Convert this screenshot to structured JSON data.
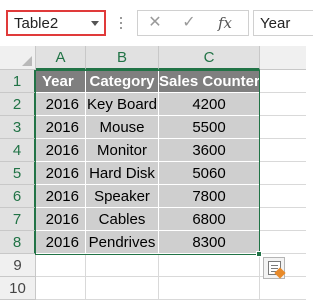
{
  "formula_bar": {
    "name_box": "Table2",
    "cancel_icon": "✕",
    "enter_icon": "✓",
    "fx_label": "fx",
    "content": "Year"
  },
  "columns": [
    "A",
    "B",
    "C"
  ],
  "rows": [
    "1",
    "2",
    "3",
    "4",
    "5",
    "6",
    "7",
    "8",
    "9",
    "10"
  ],
  "table": {
    "headers": [
      "Year",
      "Category",
      "Sales Counter"
    ],
    "data": [
      [
        "2016",
        "Key Board",
        "4200"
      ],
      [
        "2016",
        "Mouse",
        "5500"
      ],
      [
        "2016",
        "Monitor",
        "3600"
      ],
      [
        "2016",
        "Hard Disk",
        "5060"
      ],
      [
        "2016",
        "Speaker",
        "7800"
      ],
      [
        "2016",
        "Cables",
        "6800"
      ],
      [
        "2016",
        "Pendrives",
        "8300"
      ]
    ]
  },
  "colors": {
    "selection": "#217346",
    "header_fill": "#7f7f7f",
    "row_fill": "#cfcfcf",
    "namebox_highlight": "#e03a3a"
  },
  "icons": {
    "quick_analysis": "quick-analysis-icon"
  }
}
